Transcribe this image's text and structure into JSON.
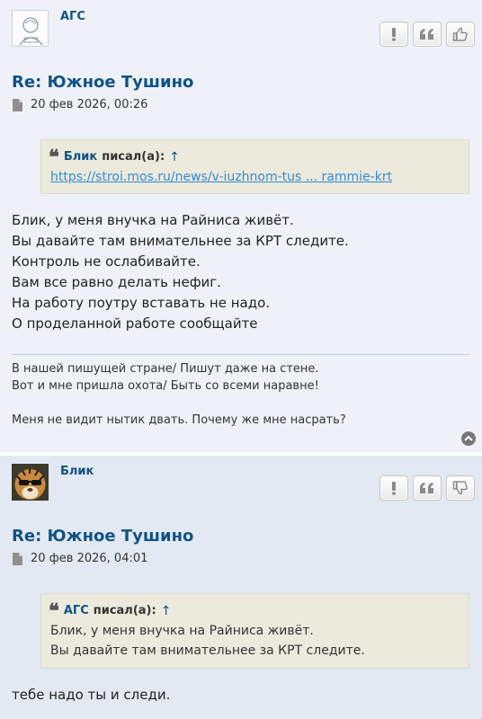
{
  "posts": [
    {
      "author": "АГС",
      "title": "Re: Южное Тушино",
      "date": "20 фев 2026, 00:26",
      "quote": {
        "author": "Блик",
        "wrote": "писал(а):",
        "arrow": "↑",
        "link": "https://stroi.mos.ru/news/v-iuzhnom-tus ... rammie-krt"
      },
      "lines": [
        "Блик, у меня внучка на Райниса живёт.",
        "Вы давайте там внимательнее за КРТ следите.",
        "Контроль не ослабивайте.",
        "Вам все равно делать нефиг.",
        "На работу поутру вставать не надо.",
        "О проделанной работе сообщайте"
      ],
      "signature": [
        "В нашей пишущей стране/ Пишут даже на стене.",
        "Вот и мне пришла охота/ Быть со всеми наравне!",
        "Меня не видит нытик двать. Почему же мне насрать?"
      ],
      "actions": [
        "report-icon",
        "quote-icon",
        "thumbs-up-icon"
      ]
    },
    {
      "author": "Блик",
      "title": "Re: Южное Тушино",
      "date": "20 фев 2026, 04:01",
      "quote": {
        "author": "АГС",
        "wrote": "писал(а):",
        "arrow": "↑",
        "lines": [
          "Блик, у меня внучка на Райниса живёт.",
          "Вы давайте там внимательнее за КРТ следите."
        ]
      },
      "lines": [
        "тебе надо ты и следи."
      ],
      "actions": [
        "report-icon",
        "quote-icon",
        "thumbs-down-icon"
      ]
    }
  ],
  "colors": {
    "post1_bg": "#eef2f8",
    "post2_bg": "#e2e9f2",
    "link": "#105289",
    "quote_bg": "#ebeadd"
  }
}
